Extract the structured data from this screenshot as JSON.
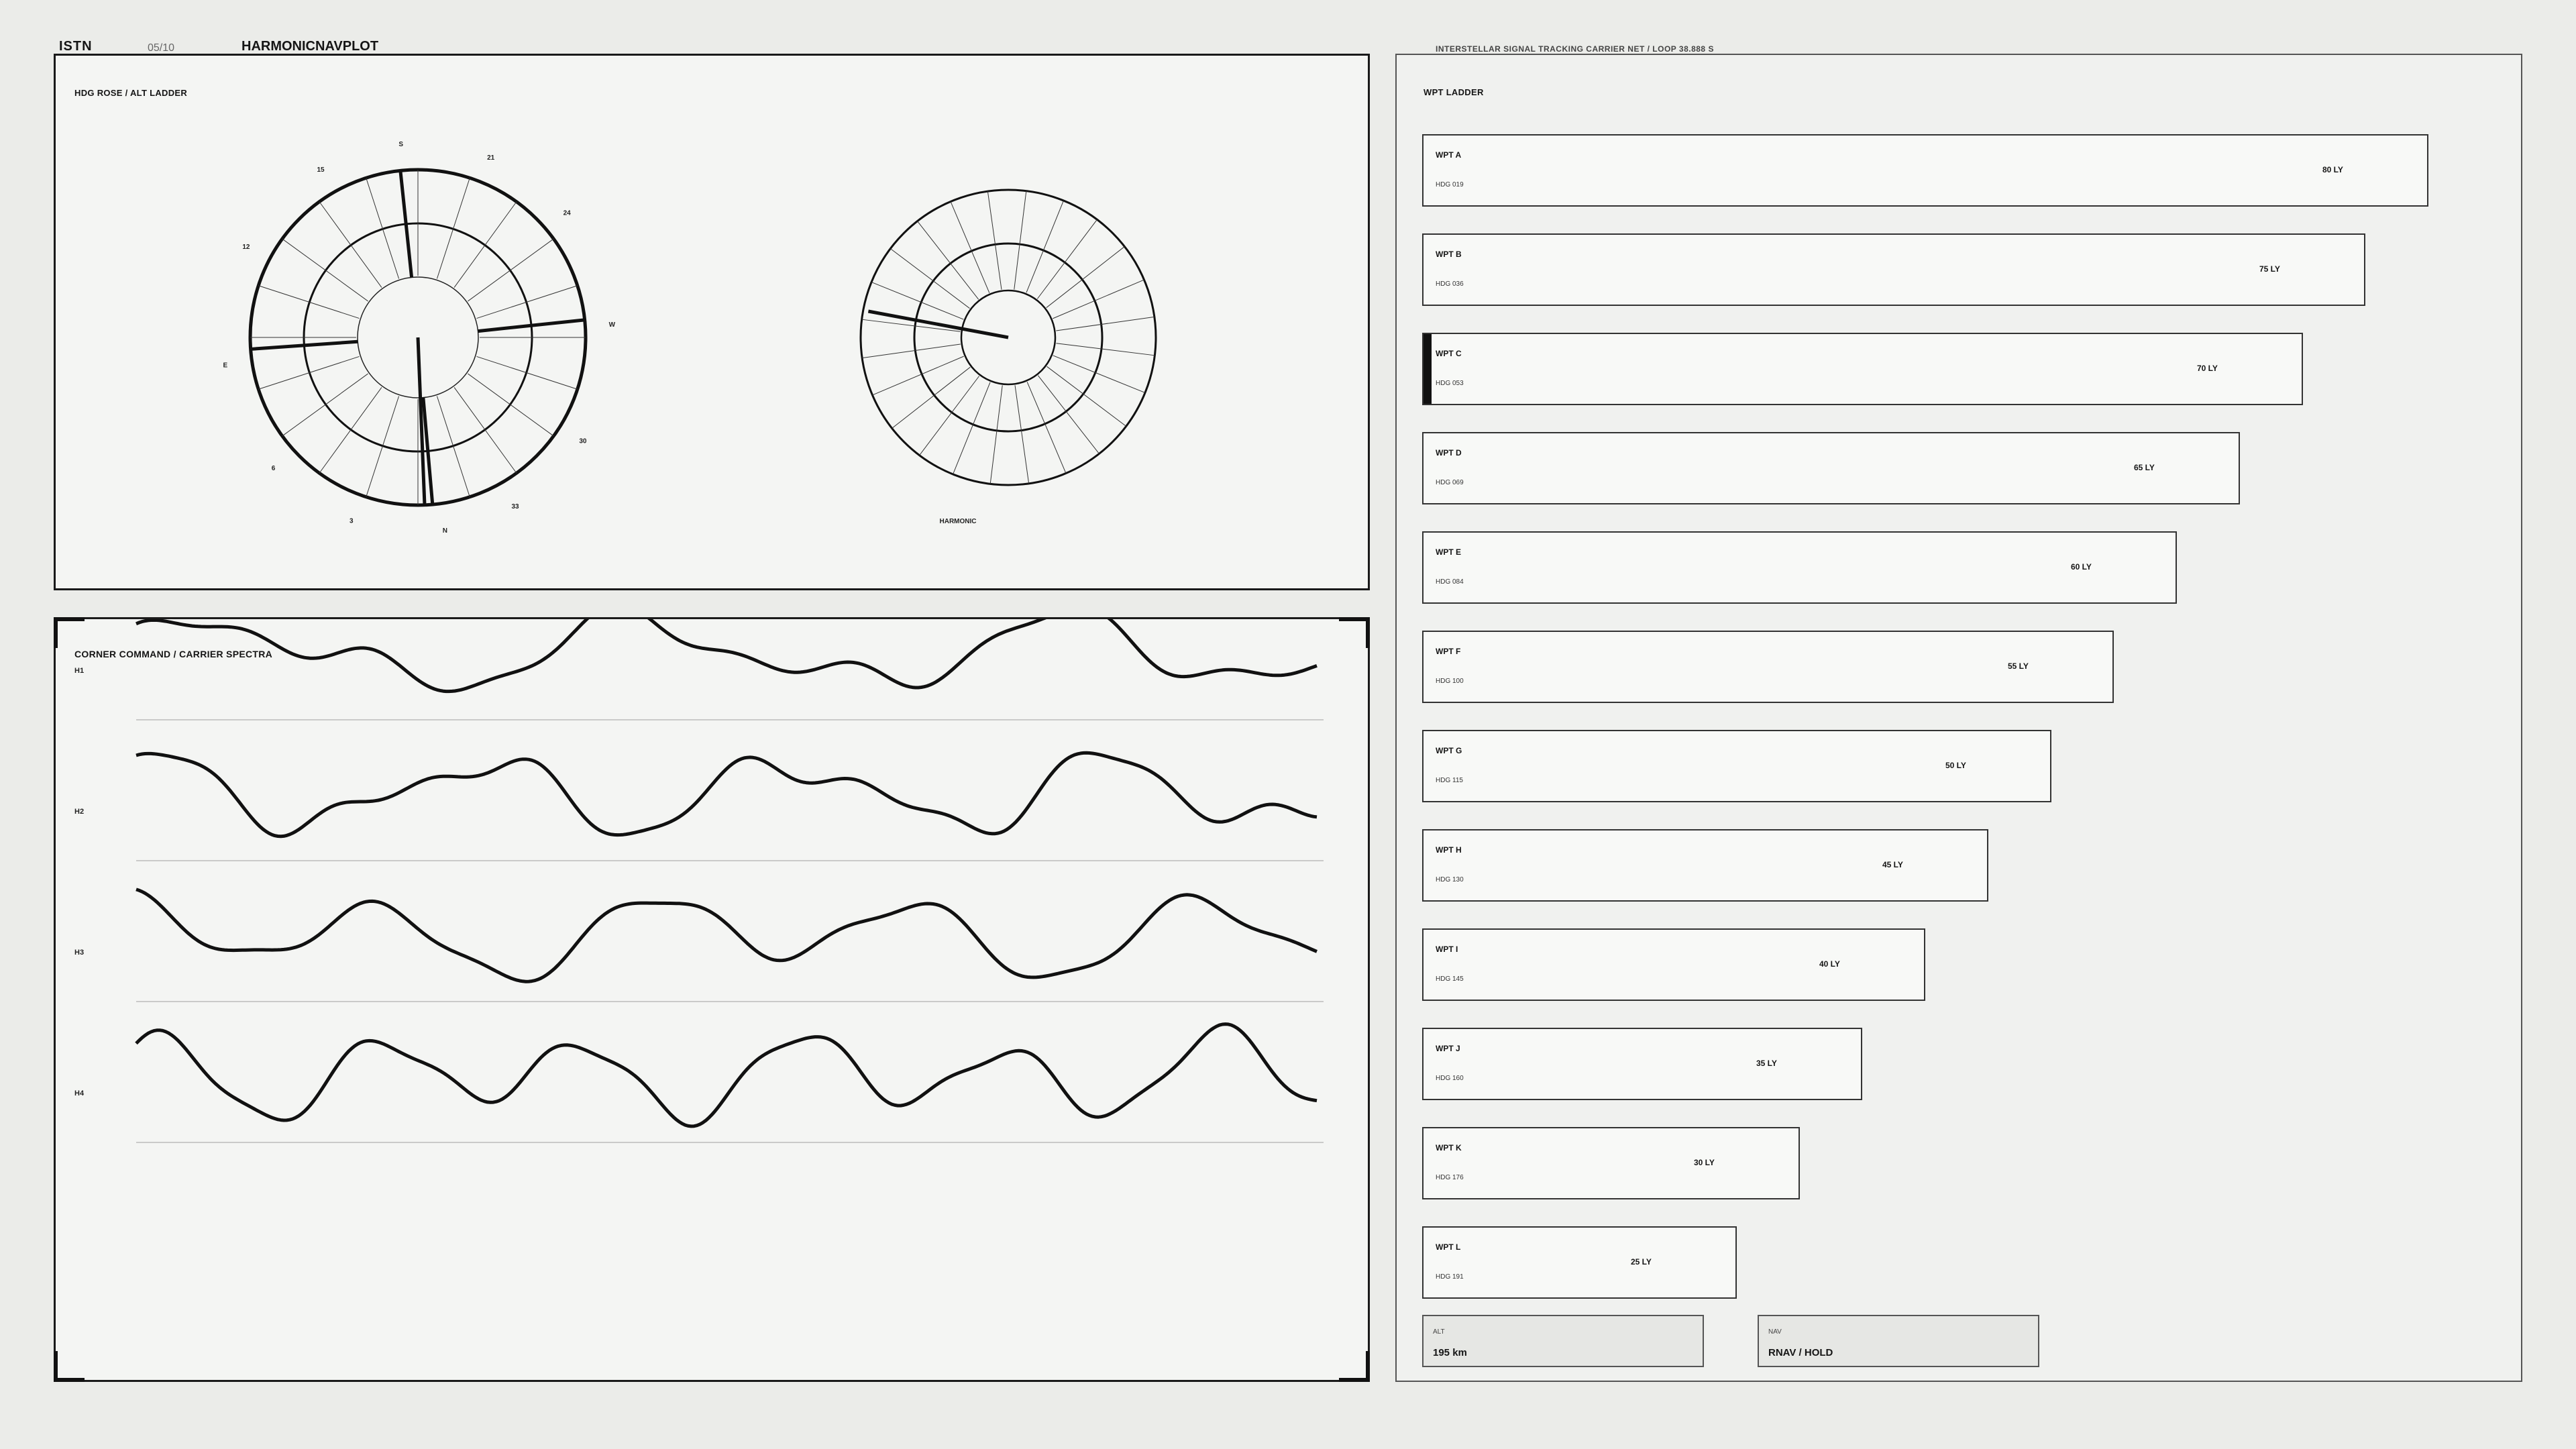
{
  "header": {
    "app": "ISTN",
    "page": "05/10",
    "title": "HARMONICNAVPLOT",
    "status": "INTERSTELLAR SIGNAL TRACKING   CARRIER NET  /  LOOP 38.888 S"
  },
  "rose_panel": {
    "title": "HDG ROSE  /  ALT LADDER",
    "labels": [
      {
        "text": "S",
        "angle": -5
      },
      {
        "text": "21",
        "angle": 22
      },
      {
        "text": "24",
        "angle": 50
      },
      {
        "text": "W",
        "angle": 86
      },
      {
        "text": "30",
        "angle": 122
      },
      {
        "text": "33",
        "angle": 150
      },
      {
        "text": "N",
        "angle": 172
      },
      {
        "text": "3",
        "angle": 200
      },
      {
        "text": "6",
        "angle": 228
      },
      {
        "text": "E",
        "angle": 262
      },
      {
        "text": "12",
        "angle": 298
      },
      {
        "text": "15",
        "angle": 330
      }
    ],
    "harmonic_label": "HARMONIC"
  },
  "spectra_panel": {
    "title": "CORNER COMMAND  /  CARRIER SPECTRA",
    "rows": [
      {
        "label": "H1",
        "freqs": [
          2.8,
          5.2,
          9.7
        ],
        "amps": [
          1,
          0.5,
          0.25
        ],
        "phases": [
          0.3,
          1.1,
          2.0
        ]
      },
      {
        "label": "H2",
        "freqs": [
          3.7,
          6.4,
          11.3
        ],
        "amps": [
          1,
          0.45,
          0.22
        ],
        "phases": [
          1.2,
          0.4,
          2.6
        ]
      },
      {
        "label": "H3",
        "freqs": [
          4.4,
          2.1,
          10.2
        ],
        "amps": [
          1,
          0.4,
          0.2
        ],
        "phases": [
          2.1,
          0.9,
          1.5
        ]
      },
      {
        "label": "H4",
        "freqs": [
          5.6,
          3.1,
          12.1
        ],
        "amps": [
          1,
          0.35,
          0.2
        ],
        "phases": [
          0.7,
          2.3,
          0.2
        ]
      }
    ]
  },
  "ladder": {
    "title": "WPT LADDER",
    "items": [
      {
        "name": "WPT A",
        "hdg": "HDG 019",
        "value": 80,
        "label": "80 LY"
      },
      {
        "name": "WPT B",
        "hdg": "HDG 036",
        "value": 75,
        "label": "75 LY"
      },
      {
        "name": "WPT C",
        "hdg": "HDG 053",
        "value": 70,
        "label": "70 LY",
        "active": true
      },
      {
        "name": "WPT D",
        "hdg": "HDG 069",
        "value": 65,
        "label": "65 LY"
      },
      {
        "name": "WPT E",
        "hdg": "HDG 084",
        "value": 60,
        "label": "60 LY"
      },
      {
        "name": "WPT F",
        "hdg": "HDG 100",
        "value": 55,
        "label": "55 LY"
      },
      {
        "name": "WPT G",
        "hdg": "HDG 115",
        "value": 50,
        "label": "50 LY"
      },
      {
        "name": "WPT H",
        "hdg": "HDG 130",
        "value": 45,
        "label": "45 LY"
      },
      {
        "name": "WPT I",
        "hdg": "HDG 145",
        "value": 40,
        "label": "40 LY"
      },
      {
        "name": "WPT J",
        "hdg": "HDG 160",
        "value": 35,
        "label": "35 LY"
      },
      {
        "name": "WPT K",
        "hdg": "HDG 176",
        "value": 30,
        "label": "30 LY"
      },
      {
        "name": "WPT L",
        "hdg": "HDG 191",
        "value": 25,
        "label": "25 LY"
      }
    ],
    "alt": {
      "key": "ALT",
      "value": "195 km"
    },
    "nav": {
      "key": "NAV",
      "value": "RNAV / HOLD"
    }
  }
}
